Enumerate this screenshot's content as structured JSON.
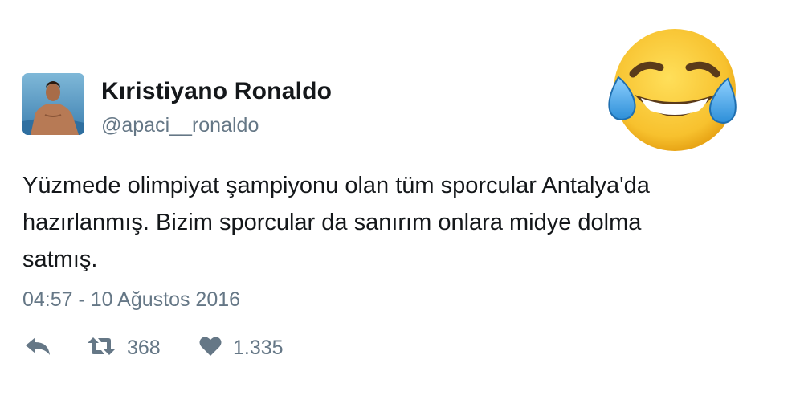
{
  "tweet": {
    "display_name": "Kıristiyano Ronaldo",
    "handle": "@apaci__ronaldo",
    "text_lines": [
      "Yüzmede olimpiyat şampiyonu olan tüm sporcular Antalya'da",
      "hazırlanmış. Bizim sporcular da sanırım onlara midye dolma",
      "satmış."
    ],
    "timestamp": "04:57 - 10 Ağustos 2016",
    "actions": {
      "reply_icon": "reply-icon",
      "retweet_icon": "retweet-icon",
      "retweet_count": "368",
      "like_icon": "heart-icon",
      "like_count": "1.335"
    },
    "emoji": "face-with-tears-of-joy"
  },
  "colors": {
    "name": "#14171a",
    "secondary": "#657786",
    "emoji_yellow": "#fbcb35",
    "tear_blue": "#4aa8e8"
  }
}
